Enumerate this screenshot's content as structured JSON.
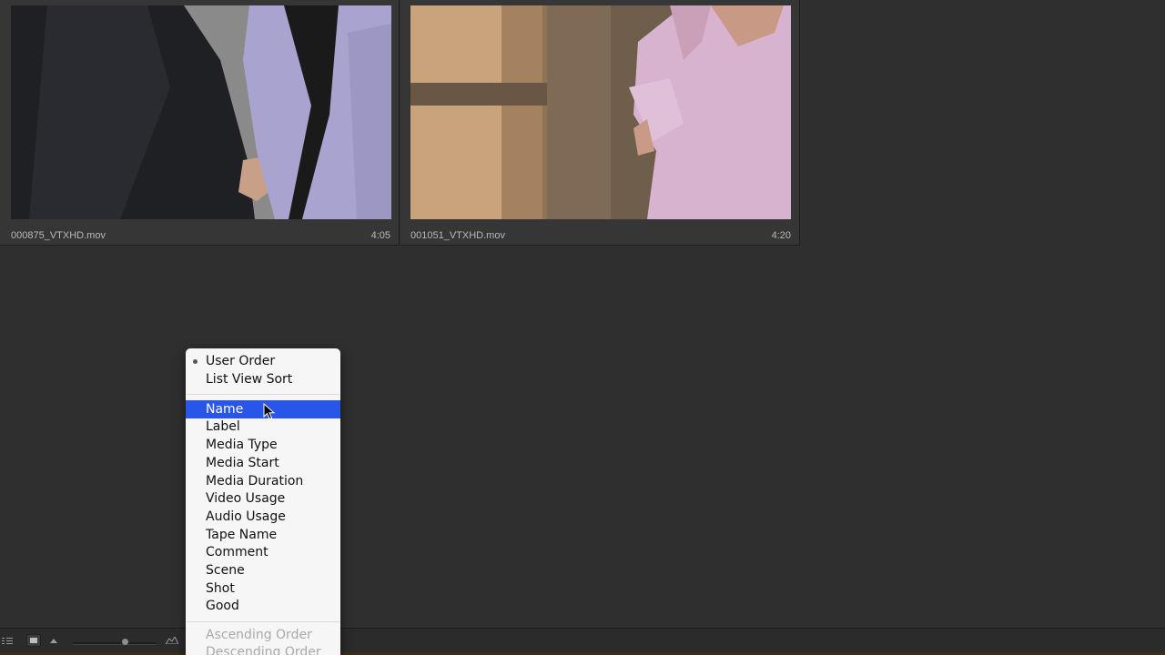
{
  "clips": [
    {
      "name": "000875_VTXHD.mov",
      "duration": "4:05"
    },
    {
      "name": "001051_VTXHD.mov",
      "duration": "4:20"
    }
  ],
  "sort_menu": {
    "order_group": [
      {
        "label": "User Order",
        "checked": true
      },
      {
        "label": "List View Sort",
        "checked": false
      }
    ],
    "field_group": [
      {
        "label": "Name",
        "highlighted": true
      },
      {
        "label": "Label"
      },
      {
        "label": "Media Type"
      },
      {
        "label": "Media Start"
      },
      {
        "label": "Media Duration"
      },
      {
        "label": "Video Usage"
      },
      {
        "label": "Audio Usage"
      },
      {
        "label": "Tape Name"
      },
      {
        "label": "Comment"
      },
      {
        "label": "Scene"
      },
      {
        "label": "Shot"
      },
      {
        "label": "Good"
      }
    ],
    "direction_group": [
      {
        "label": "Ascending Order",
        "disabled": true
      },
      {
        "label": "Descending Order",
        "disabled": true
      }
    ]
  },
  "bottom_bar": {
    "icons": [
      "list-view-icon",
      "icon-view-icon",
      "zoom-out-icon",
      "zoom-slider",
      "zoom-in-icon"
    ]
  },
  "colors": {
    "panel_bg": "#2f2f2f",
    "menu_bg": "#f6f6f6",
    "menu_highlight": "#2a55e9"
  }
}
